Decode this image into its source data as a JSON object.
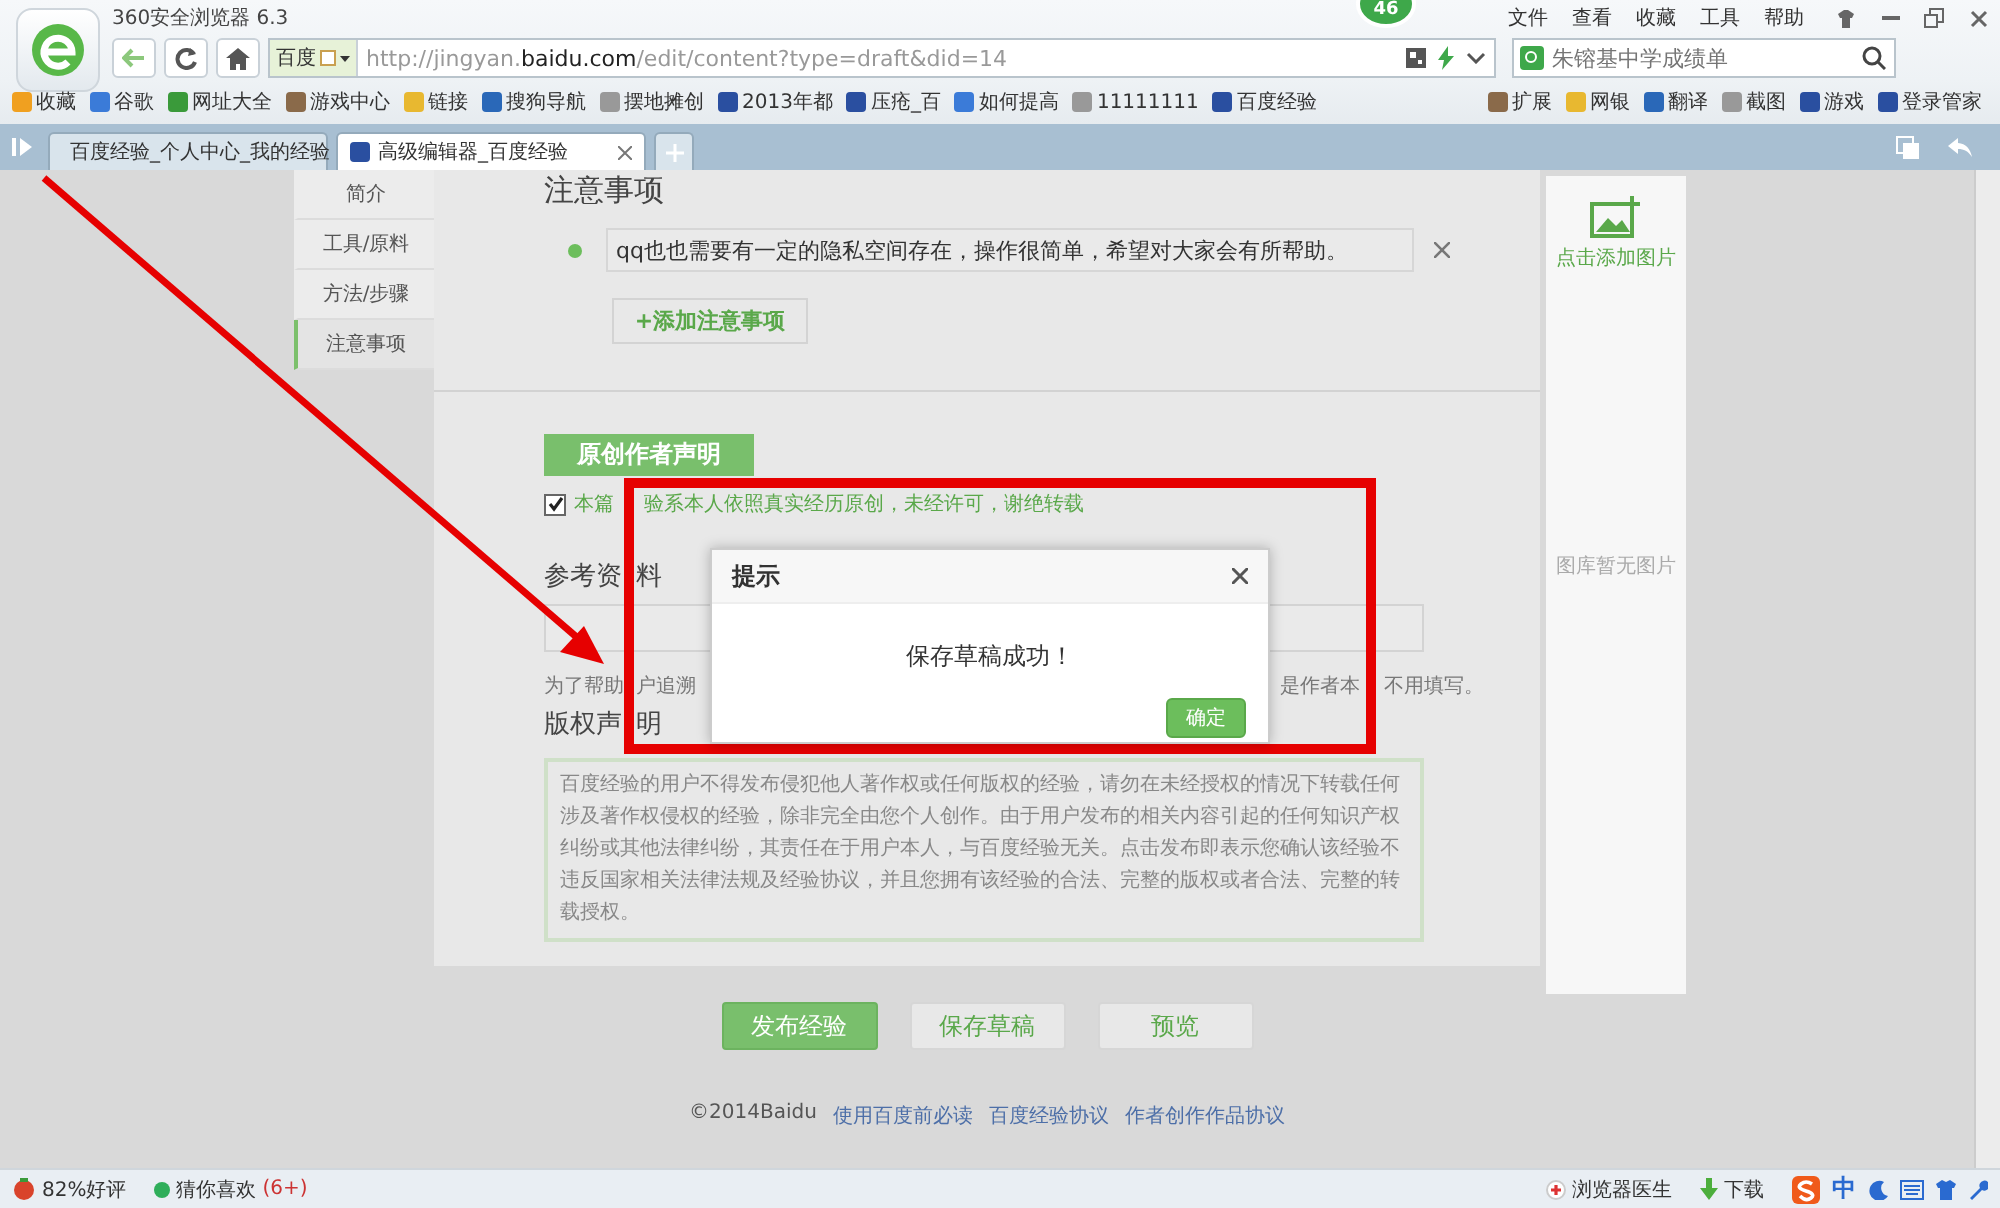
{
  "window": {
    "title": "360安全浏览器 6.3",
    "badge": "46",
    "menu": [
      "文件",
      "查看",
      "收藏",
      "工具",
      "帮助"
    ]
  },
  "address_bar": {
    "engine": "百度",
    "url": "http://jingyan.**baidu.com**/edit/content?type=draft&did=14"
  },
  "search": {
    "placeholder": "朱镕基中学成绩单"
  },
  "bookmarks": [
    "收藏",
    "谷歌",
    "网址大全",
    "游戏中心",
    "链接",
    "搜狗导航",
    "摆地摊创",
    "2013年都",
    "压疮_百",
    "如何提高",
    "11111111",
    "百度经验"
  ],
  "toolbar_right": [
    "扩展",
    "网银",
    "翻译",
    "截图",
    "游戏",
    "登录管家"
  ],
  "tabs": [
    {
      "label": "百度经验_个人中心_我的经验",
      "selected": false
    },
    {
      "label": "高级编辑器_百度经验",
      "selected": true
    }
  ],
  "sidebar": {
    "items": [
      {
        "label": "简介",
        "selected": false
      },
      {
        "label": "工具/原料",
        "selected": false
      },
      {
        "label": "方法/步骤",
        "selected": false
      },
      {
        "label": "注意事项",
        "selected": true
      }
    ]
  },
  "notes": {
    "heading": "注意事项",
    "items": [
      "qq也也需要有一定的隐私空间存在，操作很简单，希望对大家会有所帮助。"
    ],
    "add_button": "+添加注意事项"
  },
  "original_statement": {
    "header": "原创作者声明",
    "checked": true,
    "label_start": "本篇",
    "label_end": "验系本人依照真实经历原创，未经许可，谢绝转载"
  },
  "references": {
    "heading_start": "参考资",
    "heading_end": "料",
    "hint_start": "为了帮助",
    "hint_middle": "户追溯",
    "hint_right": "是作者本",
    "hint_end": "不用填写。"
  },
  "copyright": {
    "heading_start": "版权声",
    "heading_end": "明",
    "text": "百度经验的用户不得发布侵犯他人著作权或任何版权的经验，请勿在未经授权的情况下转载任何涉及著作权侵权的经验，除非完全由您个人创作。由于用户发布的相关内容引起的任何知识产权纠纷或其他法律纠纷，其责任在于用户本人，与百度经验无关。点击发布即表示您确认该经验不违反国家相关法律法规及经验协议，并且您拥有该经验的合法、完整的版权或者合法、完整的转载授权。"
  },
  "actions": [
    {
      "label": "发布经验",
      "kind": "primary"
    },
    {
      "label": "保存草稿",
      "kind": "secondary"
    },
    {
      "label": "预览",
      "kind": "secondary"
    }
  ],
  "footer": {
    "copyright": "©2014Baidu",
    "links": [
      "使用百度前必读",
      "百度经验协议",
      "作者创作作品协议"
    ]
  },
  "image_panel": {
    "add_label": "点击添加图片",
    "empty": "图库暂无图片"
  },
  "dialog": {
    "title": "提示",
    "message": "保存草稿成功！",
    "button": "确定"
  },
  "status_bar": {
    "rating": "82%好评",
    "recommend": "猜你喜欢",
    "recommend_count": "(6+)",
    "doctor": "浏览器医生",
    "download": "下载",
    "ime": "中"
  }
}
